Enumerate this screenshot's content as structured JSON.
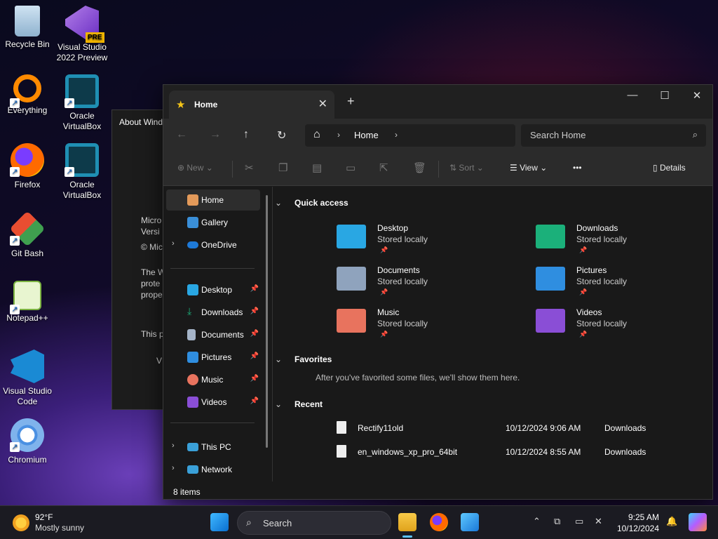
{
  "desktop": {
    "icons": [
      {
        "label": "Recycle Bin"
      },
      {
        "label": "Visual Studio 2022 Preview",
        "badge": "PRE"
      },
      {
        "label": "Everything"
      },
      {
        "label": "Oracle VirtualBox"
      },
      {
        "label": "Firefox"
      },
      {
        "label": "Oracle VirtualBox"
      },
      {
        "label": "Git Bash"
      },
      {
        "label": "Notepad++"
      },
      {
        "label": "Visual Studio Code"
      },
      {
        "label": "Chromium"
      }
    ]
  },
  "about_window": {
    "title": "About Wind",
    "lines": [
      "Micro",
      "Versi",
      "© Mic",
      "The W",
      "prote",
      "prope",
      "This p",
      "V"
    ]
  },
  "explorer": {
    "tab_title": "Home",
    "new_tab": "+",
    "address": {
      "root_icon": "home-icon",
      "crumb": "Home"
    },
    "search_placeholder": "Search Home",
    "toolbar": {
      "new": "New",
      "sort": "Sort",
      "view": "View",
      "more": "•••",
      "details": "Details"
    },
    "nav": {
      "home": "Home",
      "gallery": "Gallery",
      "onedrive": "OneDrive",
      "desktop": "Desktop",
      "downloads": "Downloads",
      "documents": "Documents",
      "pictures": "Pictures",
      "music": "Music",
      "videos": "Videos",
      "thispc": "This PC",
      "network": "Network"
    },
    "quick_access": {
      "title": "Quick access",
      "items": [
        {
          "name": "Desktop",
          "sub": "Stored locally",
          "color": "#29a7e3"
        },
        {
          "name": "Downloads",
          "sub": "Stored locally",
          "color": "#1bb07a"
        },
        {
          "name": "Documents",
          "sub": "Stored locally",
          "color": "#8fa3bd"
        },
        {
          "name": "Pictures",
          "sub": "Stored locally",
          "color": "#2f8ee0"
        },
        {
          "name": "Music",
          "sub": "Stored locally",
          "color": "#e8735e"
        },
        {
          "name": "Videos",
          "sub": "Stored locally",
          "color": "#8a4ed6"
        }
      ]
    },
    "favorites": {
      "title": "Favorites",
      "empty_text": "After you've favorited some files, we'll show them here."
    },
    "recent": {
      "title": "Recent",
      "files": [
        {
          "name": "Rectify11old",
          "date": "10/12/2024 9:06 AM",
          "location": "Downloads"
        },
        {
          "name": "en_windows_xp_pro_64bit",
          "date": "10/12/2024 8:55 AM",
          "location": "Downloads"
        }
      ]
    },
    "status": "8 items"
  },
  "taskbar": {
    "weather_temp": "92°F",
    "weather_desc": "Mostly sunny",
    "search_label": "Search",
    "time": "9:25 AM",
    "date": "10/12/2024"
  }
}
